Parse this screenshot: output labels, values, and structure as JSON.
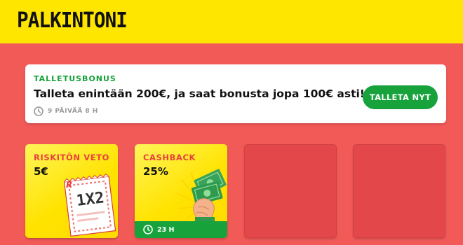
{
  "header": {
    "title": "PALKINTONI"
  },
  "bonus": {
    "kicker": "TALLETUSBONUS",
    "text": "Talleta enintään 200€, ja saat bonusta jopa 100€ asti!",
    "time_left": "9 PÄIVÄÄ 8 H",
    "cta_label": "TALLETA NYT"
  },
  "cards": [
    {
      "title": "RISKITÖN VETO",
      "value": "5€",
      "art_text": "1X2",
      "art_letter": "R"
    },
    {
      "title": "CASHBACK",
      "value": "25%",
      "timer": "23 H"
    }
  ],
  "colors": {
    "background": "#f25a58",
    "header": "#ffe600",
    "accent_green": "#17a23c",
    "card_title_red": "#e8403f"
  }
}
